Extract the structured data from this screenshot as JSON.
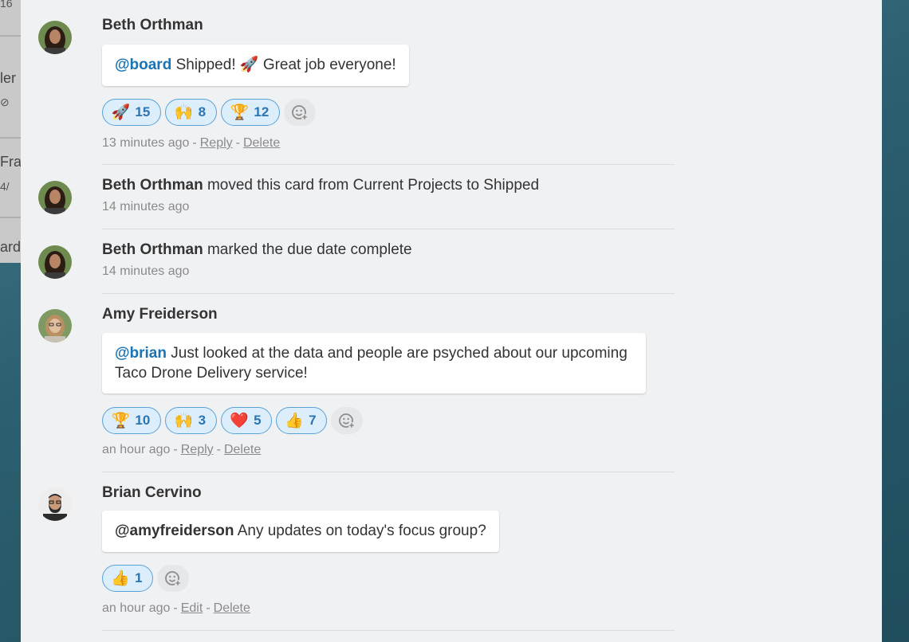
{
  "board_fragments": [
    "16",
    "ler",
    "Fra",
    "4/",
    "ard"
  ],
  "entries": [
    {
      "type": "comment",
      "author": "Beth Orthman",
      "mention": "@board",
      "text": " Shipped! 🚀 Great job everyone!",
      "reactions": [
        {
          "emoji": "🚀",
          "count": "15"
        },
        {
          "emoji": "🙌",
          "count": "8"
        },
        {
          "emoji": "🏆",
          "count": "12"
        }
      ],
      "time": "13 minutes ago",
      "actions": [
        "Reply",
        "Delete"
      ]
    },
    {
      "type": "activity",
      "author": "Beth Orthman",
      "text": " moved this card from Current Projects to Shipped",
      "time": "14 minutes ago"
    },
    {
      "type": "activity",
      "author": "Beth Orthman",
      "text": " marked the due date complete",
      "time": "14 minutes ago"
    },
    {
      "type": "comment",
      "author": "Amy Freiderson",
      "mention": "@brian",
      "text": " Just looked at the data and people are psyched about our upcoming Taco Drone Delivery service!",
      "reactions": [
        {
          "emoji": "🏆",
          "count": "10"
        },
        {
          "emoji": "🙌",
          "count": "3"
        },
        {
          "emoji": "❤️",
          "count": "5"
        },
        {
          "emoji": "👍",
          "count": "7"
        }
      ],
      "time": "an hour ago",
      "actions": [
        "Reply",
        "Delete"
      ]
    },
    {
      "type": "comment",
      "author": "Brian Cervino",
      "mention": "@amyfreiderson",
      "text": " Any updates on today's focus group?",
      "reactions": [
        {
          "emoji": "👍",
          "count": "1"
        }
      ],
      "time": "an hour ago",
      "actions": [
        "Edit",
        "Delete"
      ]
    }
  ],
  "icons": {
    "add_reaction": "smiley-plus-icon",
    "avatar": "user-avatar-icon"
  },
  "colors": {
    "mention": "#1a73b5",
    "reaction_bg": "#dceefb",
    "reaction_border": "#5aa2d6",
    "reaction_count": "#2a76b3"
  }
}
